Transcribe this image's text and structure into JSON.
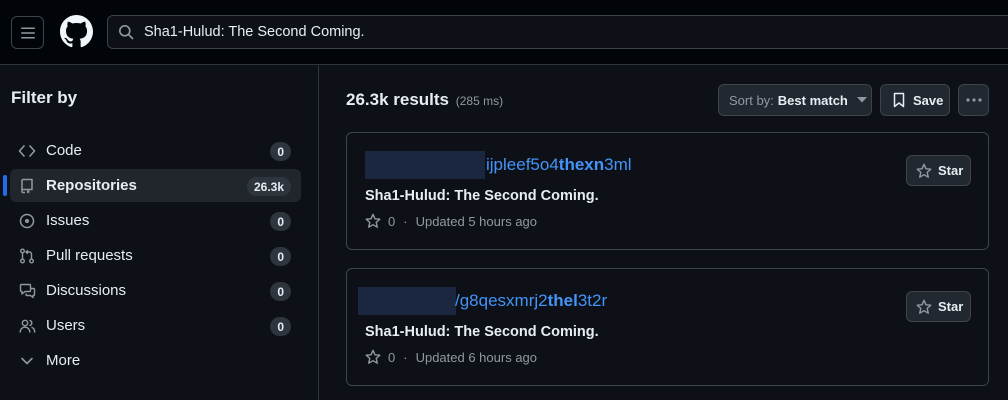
{
  "header": {
    "search_text": "Sha1-Hulud: The Second Coming."
  },
  "sidebar": {
    "title": "Filter by",
    "items": [
      {
        "label": "Code",
        "count": "0",
        "icon": "code-icon"
      },
      {
        "label": "Repositories",
        "count": "26.3k",
        "icon": "repo-icon",
        "active": true
      },
      {
        "label": "Issues",
        "count": "0",
        "icon": "issue-icon"
      },
      {
        "label": "Pull requests",
        "count": "0",
        "icon": "pull-request-icon"
      },
      {
        "label": "Discussions",
        "count": "0",
        "icon": "discussion-icon"
      },
      {
        "label": "Users",
        "count": "0",
        "icon": "people-icon"
      },
      {
        "label": "More",
        "icon": "chevron-down-icon"
      }
    ]
  },
  "main": {
    "results_count": "26.3k results",
    "results_time": "(285 ms)",
    "sort_prefix": "Sort by:",
    "sort_value": "Best match",
    "save_label": "Save",
    "results": [
      {
        "repo_part1": "ijpleef5o4",
        "repo_bold": "thexn",
        "repo_part2": "3ml",
        "description": "Sha1-Hulud: The Second Coming.",
        "stars": "0",
        "updated": "Updated 5 hours ago",
        "star_label": "Star"
      },
      {
        "repo_part1": "/g8qesxmrj2",
        "repo_bold": "thel",
        "repo_part2": "3t2r",
        "description": "Sha1-Hulud: The Second Coming.",
        "stars": "0",
        "updated": "Updated 6 hours ago",
        "star_label": "Star"
      }
    ]
  },
  "colors": {
    "accent_blue": "#4493f8",
    "active_indicator": "#1f6feb",
    "background": "#0d1117",
    "header_bg": "#010409"
  }
}
